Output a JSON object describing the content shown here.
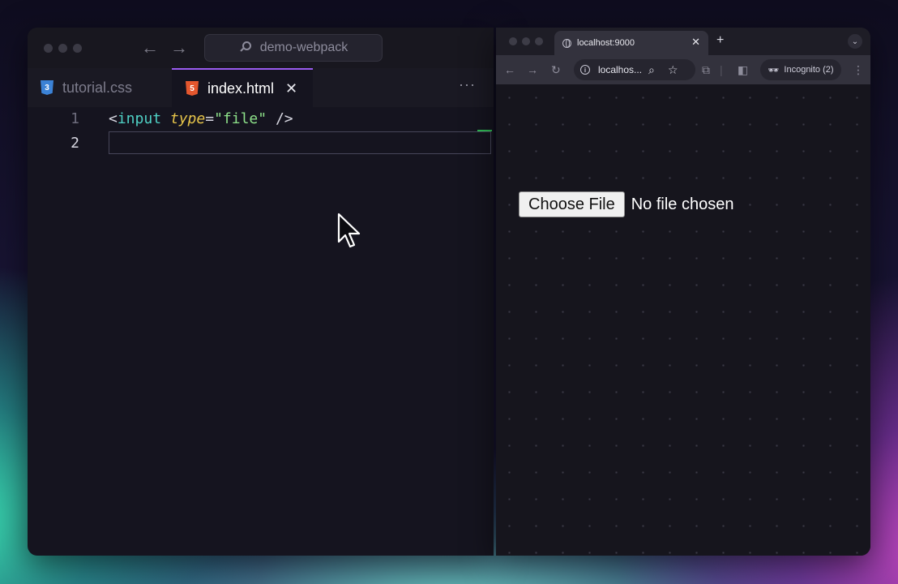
{
  "editor": {
    "command_center": {
      "label": "demo-webpack"
    },
    "tabs": [
      {
        "label": "tutorial.css",
        "icon": "css-file-icon",
        "active": false
      },
      {
        "label": "index.html",
        "icon": "html-file-icon",
        "active": true
      }
    ],
    "more_label": "···",
    "code_lines": [
      {
        "number": "1",
        "open": "<",
        "tag": "input",
        "attr": "type",
        "eq": "=",
        "value": "\"file\"",
        "close": " />"
      },
      {
        "number": "2"
      }
    ],
    "colors": {
      "tag": "#4fd1c5",
      "attr": "#e6c44a",
      "string": "#8ee28a",
      "accent": "#9a5cf0"
    }
  },
  "browser": {
    "tab": {
      "title": "localhost:9000"
    },
    "address": {
      "text": "localhos..."
    },
    "incognito": {
      "label": "Incognito (2)"
    },
    "page": {
      "file_button_label": "Choose File",
      "file_status": "No file chosen"
    }
  }
}
